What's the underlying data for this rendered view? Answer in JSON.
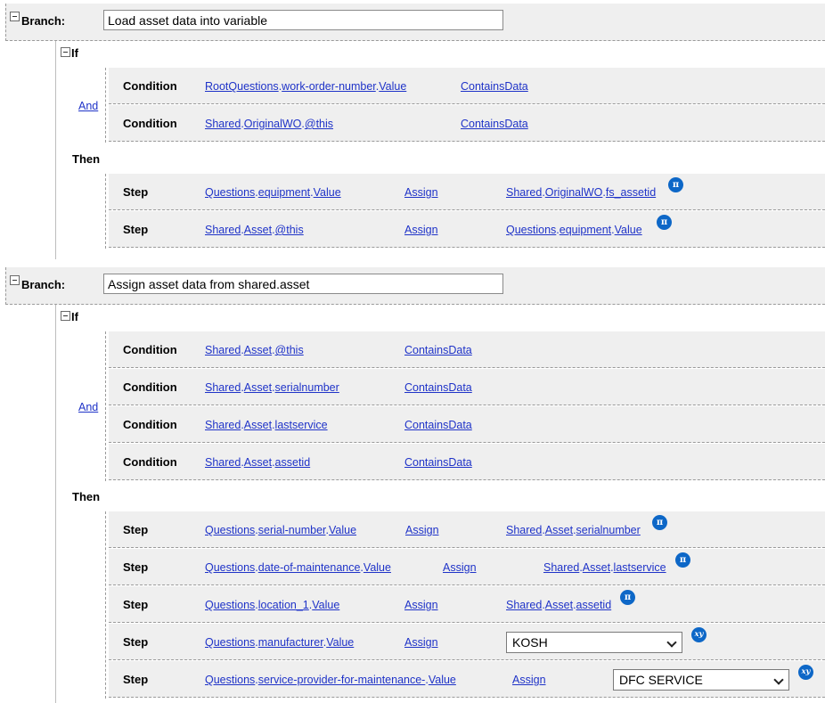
{
  "branches": [
    {
      "label": "Branch:",
      "name": "Load asset data into variable",
      "if_label": "If",
      "operator": "And",
      "then_label": "Then",
      "conditions": [
        {
          "label": "Condition",
          "path": [
            "RootQuestions",
            "work-order-number",
            "Value"
          ],
          "test": "ContainsData"
        },
        {
          "label": "Condition",
          "path": [
            "Shared",
            "OriginalWO",
            "@this"
          ],
          "test": "ContainsData"
        }
      ],
      "steps": [
        {
          "label": "Step",
          "target": [
            "Questions",
            "equipment",
            "Value"
          ],
          "action": "Assign",
          "source": [
            "Shared",
            "OriginalWO",
            "fs_assetid"
          ],
          "icon": "π",
          "icon_name": "pi-icon"
        },
        {
          "label": "Step",
          "target": [
            "Shared",
            "Asset",
            "@this"
          ],
          "action": "Assign",
          "source": [
            "Questions",
            "equipment",
            "Value"
          ],
          "icon": "π",
          "icon_name": "pi-icon"
        }
      ]
    },
    {
      "label": "Branch:",
      "name": "Assign asset data from shared.asset",
      "if_label": "If",
      "operator": "And",
      "then_label": "Then",
      "conditions": [
        {
          "label": "Condition",
          "path": [
            "Shared",
            "Asset",
            "@this"
          ],
          "test": "ContainsData"
        },
        {
          "label": "Condition",
          "path": [
            "Shared",
            "Asset",
            "serialnumber"
          ],
          "test": "ContainsData"
        },
        {
          "label": "Condition",
          "path": [
            "Shared",
            "Asset",
            "lastservice"
          ],
          "test": "ContainsData"
        },
        {
          "label": "Condition",
          "path": [
            "Shared",
            "Asset",
            "assetid"
          ],
          "test": "ContainsData"
        }
      ],
      "steps": [
        {
          "label": "Step",
          "target": [
            "Questions",
            "serial-number",
            "Value"
          ],
          "action": "Assign",
          "source": [
            "Shared",
            "Asset",
            "serialnumber"
          ],
          "icon": "π",
          "icon_name": "pi-icon"
        },
        {
          "label": "Step",
          "target": [
            "Questions",
            "date-of-maintenance",
            "Value"
          ],
          "action": "Assign",
          "source": [
            "Shared",
            "Asset",
            "lastservice"
          ],
          "icon": "π",
          "icon_name": "pi-icon"
        },
        {
          "label": "Step",
          "target": [
            "Questions",
            "location_1",
            "Value"
          ],
          "action": "Assign",
          "source": [
            "Shared",
            "Asset",
            "assetid"
          ],
          "icon": "π",
          "icon_name": "pi-icon"
        },
        {
          "label": "Step",
          "target": [
            "Questions",
            "manufacturer",
            "Value"
          ],
          "action": "Assign",
          "select": "KOSH",
          "icon": "xy",
          "icon_name": "xy-icon"
        },
        {
          "label": "Step",
          "target": [
            "Questions",
            "service-provider-for-maintenance-",
            "Value"
          ],
          "action": "Assign",
          "select": "DFC SERVICE",
          "icon": "xy",
          "icon_name": "xy-icon"
        }
      ]
    }
  ]
}
